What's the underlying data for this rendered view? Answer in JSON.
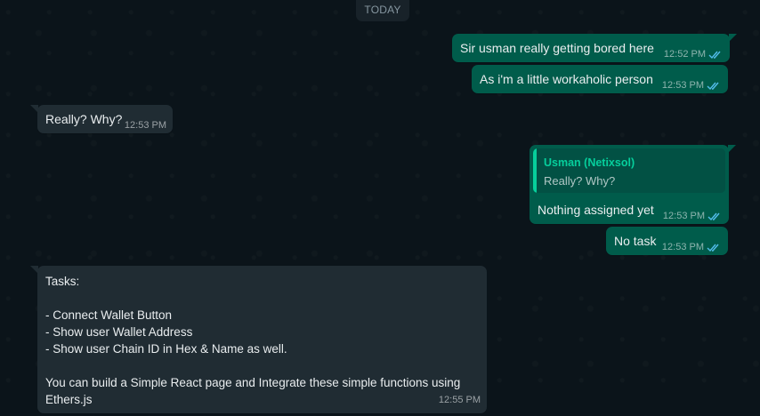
{
  "date_label": "TODAY",
  "messages": [
    {
      "text": "Sir usman really getting bored here",
      "time": "12:52 PM"
    },
    {
      "text": "As i'm a little workaholic person",
      "time": "12:53 PM"
    },
    {
      "text": "Really? Why?",
      "time": "12:53 PM"
    },
    {
      "quote_author": "Usman (Netixsol)",
      "quote_text": "Really? Why?",
      "text": "Nothing assigned yet",
      "time": "12:53 PM"
    },
    {
      "text": "No task",
      "time": "12:53 PM"
    },
    {
      "text": "Tasks:\n\n- Connect Wallet Button\n- Show user Wallet Address\n- Show user Chain ID in Hex & Name as well.\n\nYou can build a Simple React page and Integrate these simple functions using\nEthers.js",
      "time": "12:55 PM"
    }
  ],
  "colors": {
    "outgoing": "#005c4b",
    "incoming": "#202c33",
    "read_ticks": "#53bdeb",
    "quote_author": "#06cf9c"
  },
  "icons": {
    "read_receipt": "double-check-icon"
  }
}
